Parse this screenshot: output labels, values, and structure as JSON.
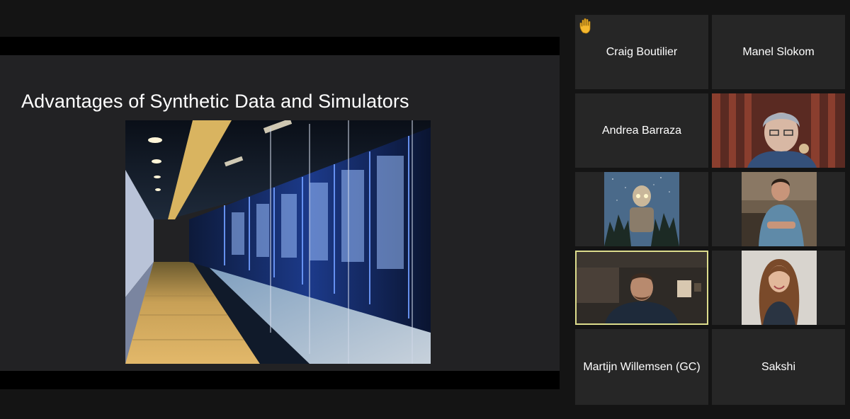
{
  "slide": {
    "title": "Advantages of Synthetic Data and Simulators",
    "image": "data-center-server-corridor"
  },
  "participants": [
    {
      "name": "Craig Boutilier",
      "raised_hand": true,
      "icon": "raised-hand-icon"
    },
    {
      "name": "Manel Slokom"
    },
    {
      "name": "Andrea Barraza"
    },
    {
      "name": "",
      "video": "man-with-glasses"
    },
    {
      "name": "",
      "video": "robot-avatar"
    },
    {
      "name": "",
      "video": "man-in-denim-shirt"
    },
    {
      "name": "",
      "video": "man-in-room",
      "active_speaker": true
    },
    {
      "name": "",
      "video": "woman-with-long-hair"
    },
    {
      "name": "Martijn Willemsen (GC)"
    },
    {
      "name": "Sakshi"
    }
  ],
  "colors": {
    "background": "#141414",
    "tile": "#262626",
    "active_speaker_border": "#dcdc8c",
    "hand": "#f5b82e"
  }
}
